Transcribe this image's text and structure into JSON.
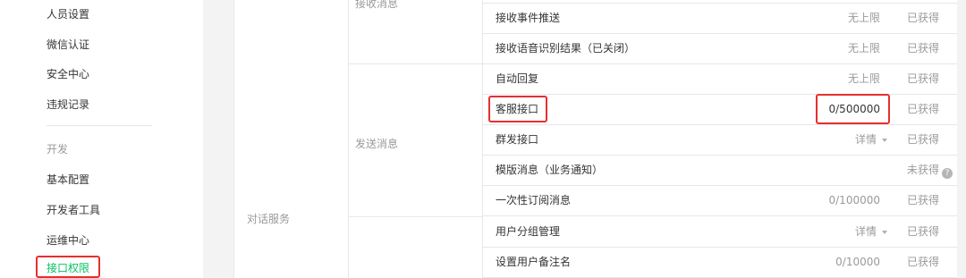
{
  "sidebar": {
    "items": [
      {
        "label": "人员设置"
      },
      {
        "label": "微信认证"
      },
      {
        "label": "安全中心"
      },
      {
        "label": "违规记录"
      }
    ],
    "group_label": "开发",
    "dev_items": [
      {
        "label": "基本配置"
      },
      {
        "label": "开发者工具"
      },
      {
        "label": "运维中心"
      },
      {
        "label": "接口权限"
      }
    ]
  },
  "table": {
    "service_category": "对话服务",
    "groups": [
      {
        "name": "接收消息"
      },
      {
        "name": "发送消息"
      }
    ],
    "rows": [
      {
        "name": "接收事件推送",
        "limit": "无上限",
        "status": "已获得"
      },
      {
        "name": "接收语音识别结果（已关闭）",
        "limit": "无上限",
        "status": "已获得"
      },
      {
        "name": "自动回复",
        "limit": "无上限",
        "status": "已获得"
      },
      {
        "name": "客服接口",
        "limit": "0/500000",
        "status": "已获得"
      },
      {
        "name": "群发接口",
        "limit": "详情",
        "status": "已获得"
      },
      {
        "name": "模版消息（业务通知）",
        "limit": "",
        "status": "未获得"
      },
      {
        "name": "一次性订阅消息",
        "limit": "0/100000",
        "status": "已获得"
      },
      {
        "name": "用户分组管理",
        "limit": "详情",
        "status": "已获得"
      },
      {
        "name": "设置用户备注名",
        "limit": "0/10000",
        "status": "已获得"
      }
    ]
  },
  "colors": {
    "highlight": "#e5302f",
    "active_nav": "#07c160"
  }
}
